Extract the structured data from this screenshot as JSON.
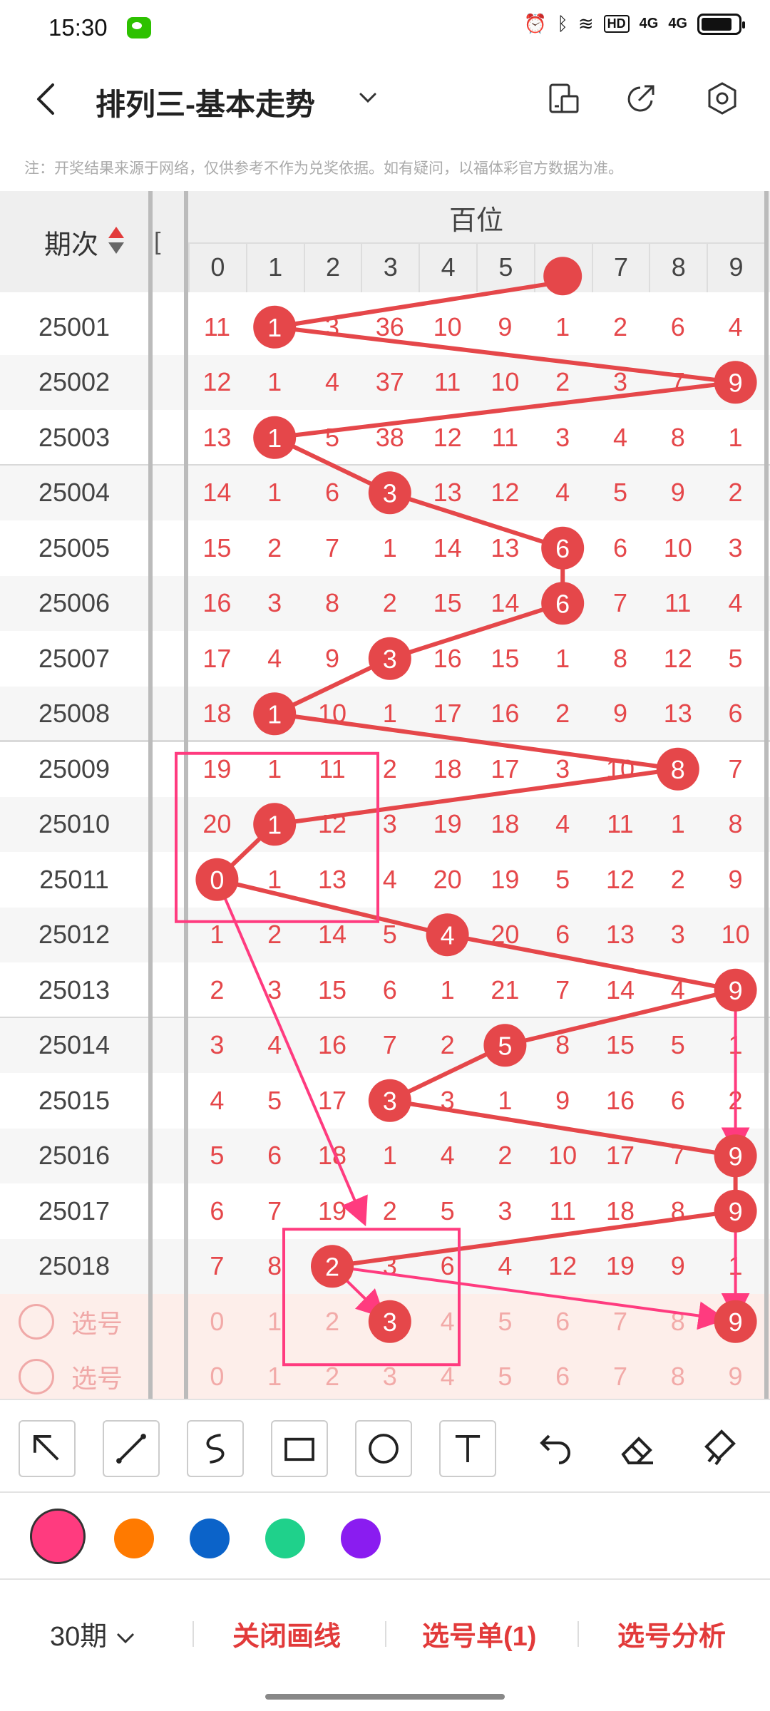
{
  "status_bar": {
    "time": "15:30",
    "network": "4G",
    "hd": "HD"
  },
  "header": {
    "title": "排列三-基本走势",
    "icons": [
      "back-icon",
      "caret-down-icon",
      "device-icon",
      "share-icon",
      "settings-icon"
    ]
  },
  "note": "注：开奖结果来源于网络，仅供参考不作为兑奖依据。如有疑问，以福体彩官方数据为准。",
  "table": {
    "issue_header": "期次",
    "group_header": "百位",
    "digits": [
      "0",
      "1",
      "2",
      "3",
      "4",
      "5",
      "6",
      "7",
      "8",
      "9"
    ],
    "rows": [
      {
        "issue": "25001",
        "cells": [
          "11",
          "1",
          "3",
          "36",
          "10",
          "9",
          "1",
          "2",
          "6",
          "4"
        ],
        "hit": 1
      },
      {
        "issue": "25002",
        "cells": [
          "12",
          "1",
          "4",
          "37",
          "11",
          "10",
          "2",
          "3",
          "7",
          "9"
        ],
        "hit": 9
      },
      {
        "issue": "25003",
        "cells": [
          "13",
          "1",
          "5",
          "38",
          "12",
          "11",
          "3",
          "4",
          "8",
          "1"
        ],
        "hit": 1
      },
      {
        "issue": "25004",
        "cells": [
          "14",
          "1",
          "6",
          "3",
          "13",
          "12",
          "4",
          "5",
          "9",
          "2"
        ],
        "hit": 3
      },
      {
        "issue": "25005",
        "cells": [
          "15",
          "2",
          "7",
          "1",
          "14",
          "13",
          "6",
          "6",
          "10",
          "3"
        ],
        "hit": 6
      },
      {
        "issue": "25006",
        "cells": [
          "16",
          "3",
          "8",
          "2",
          "15",
          "14",
          "6",
          "7",
          "11",
          "4"
        ],
        "hit": 6
      },
      {
        "issue": "25007",
        "cells": [
          "17",
          "4",
          "9",
          "3",
          "16",
          "15",
          "1",
          "8",
          "12",
          "5"
        ],
        "hit": 3
      },
      {
        "issue": "25008",
        "cells": [
          "18",
          "1",
          "10",
          "1",
          "17",
          "16",
          "2",
          "9",
          "13",
          "6"
        ],
        "hit": 1
      },
      {
        "issue": "25009",
        "cells": [
          "19",
          "1",
          "11",
          "2",
          "18",
          "17",
          "3",
          "10",
          "8",
          "7"
        ],
        "hit": 8
      },
      {
        "issue": "25010",
        "cells": [
          "20",
          "1",
          "12",
          "3",
          "19",
          "18",
          "4",
          "11",
          "1",
          "8"
        ],
        "hit": 1
      },
      {
        "issue": "25011",
        "cells": [
          "0",
          "1",
          "13",
          "4",
          "20",
          "19",
          "5",
          "12",
          "2",
          "9"
        ],
        "hit": 0
      },
      {
        "issue": "25012",
        "cells": [
          "1",
          "2",
          "14",
          "5",
          "4",
          "20",
          "6",
          "13",
          "3",
          "10"
        ],
        "hit": 4
      },
      {
        "issue": "25013",
        "cells": [
          "2",
          "3",
          "15",
          "6",
          "1",
          "21",
          "7",
          "14",
          "4",
          "9"
        ],
        "hit": 9
      },
      {
        "issue": "25014",
        "cells": [
          "3",
          "4",
          "16",
          "7",
          "2",
          "5",
          "8",
          "15",
          "5",
          "1"
        ],
        "hit": 5
      },
      {
        "issue": "25015",
        "cells": [
          "4",
          "5",
          "17",
          "3",
          "3",
          "1",
          "9",
          "16",
          "6",
          "2"
        ],
        "hit": 3
      },
      {
        "issue": "25016",
        "cells": [
          "5",
          "6",
          "18",
          "1",
          "4",
          "2",
          "10",
          "17",
          "7",
          "9"
        ],
        "hit": 9
      },
      {
        "issue": "25017",
        "cells": [
          "6",
          "7",
          "19",
          "2",
          "5",
          "3",
          "11",
          "18",
          "8",
          "9"
        ],
        "hit": 9
      },
      {
        "issue": "25018",
        "cells": [
          "7",
          "8",
          "2",
          "3",
          "6",
          "4",
          "12",
          "19",
          "9",
          "1"
        ],
        "hit": 2
      }
    ],
    "pick_rows": [
      {
        "label": "选号",
        "cells": [
          "0",
          "1",
          "2",
          "3",
          "4",
          "5",
          "6",
          "7",
          "8",
          "9"
        ],
        "selected": [
          3,
          9
        ]
      },
      {
        "label": "选号",
        "cells": [
          "0",
          "1",
          "2",
          "3",
          "4",
          "5",
          "6",
          "7",
          "8",
          "9"
        ],
        "selected": []
      }
    ]
  },
  "toolbar": {
    "tools": [
      "arrow-tool",
      "line-tool",
      "curve-tool",
      "rectangle-tool",
      "circle-tool",
      "text-tool",
      "undo-tool",
      "eraser-tool",
      "clear-tool"
    ]
  },
  "palette": {
    "colors": [
      "#ff3b7f",
      "#ff7a00",
      "#0b63c9",
      "#1fd18b",
      "#8a1cf0"
    ],
    "selected": "#ff3b7f"
  },
  "bottom_bar": {
    "period": "30期",
    "close_draw": "关闭画线",
    "pick_list": "选号单(1)",
    "pick_analysis": "选号分析"
  }
}
